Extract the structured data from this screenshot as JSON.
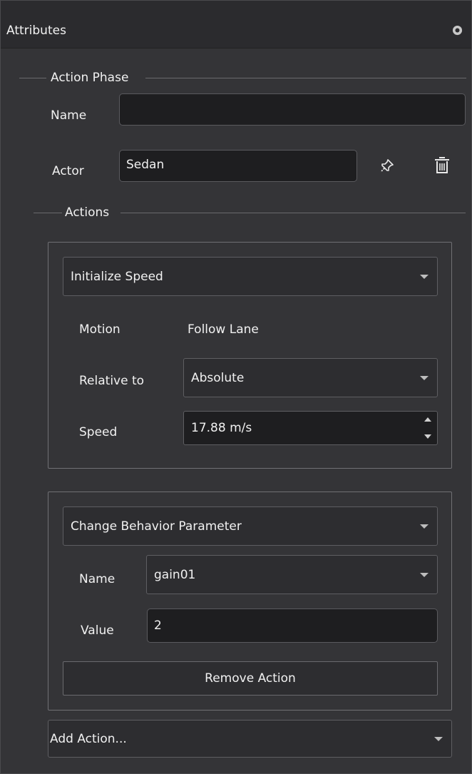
{
  "panel": {
    "title": "Attributes"
  },
  "action_phase": {
    "group_label": "Action Phase",
    "name_label": "Name",
    "name_value": "",
    "actor_label": "Actor",
    "actor_value": "Sedan"
  },
  "actions": {
    "group_label": "Actions",
    "items": [
      {
        "type": "Initialize Speed",
        "motion_label": "Motion",
        "motion_value": "Follow Lane",
        "relative_label": "Relative to",
        "relative_value": "Absolute",
        "speed_label": "Speed",
        "speed_value": "17.88 m/s"
      },
      {
        "type": "Change Behavior Parameter",
        "name_label": "Name",
        "name_value": "gain01",
        "value_label": "Value",
        "value_value": "2",
        "remove_label": "Remove Action"
      }
    ],
    "add_label": "Add Action..."
  },
  "colors": {
    "background": "#343437",
    "titlebar": "#2b2b2e",
    "field_background": "#1e1e20",
    "text": "#f1f1f1"
  }
}
